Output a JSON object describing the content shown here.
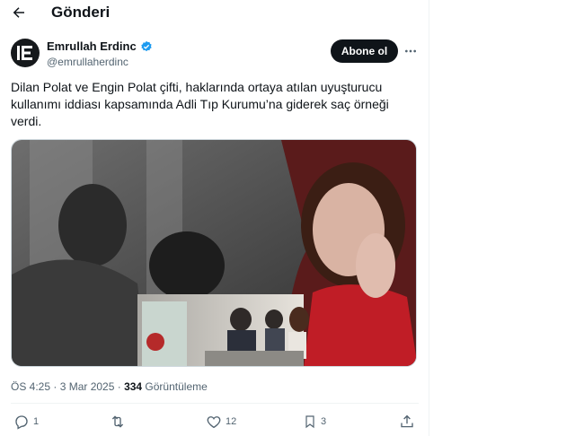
{
  "header": {
    "title": "Gönderi"
  },
  "author": {
    "name": "Emrullah Erdinc",
    "handle": "@emrullaherdinc",
    "verified": true,
    "avatar_text": "E"
  },
  "subscribe_label": "Abone ol",
  "tweet": {
    "lines": [
      "Dilan Polat ve Engin Polat çifti, haklarında ortaya atılan uyuşturucu",
      "kullanımı iddiası kapsamında Adli Tıp Kurumu’na giderek saç örneği",
      "verdi."
    ]
  },
  "meta": {
    "time_date": "ÖS 4:25 · 3 Mar 2025 · ",
    "views_count": "334",
    "views_label": " Görüntüleme"
  },
  "actions": {
    "replies": "1",
    "reposts": "",
    "likes": "12",
    "bookmarks": "3"
  },
  "colors": {
    "accent": "#1d9bf0",
    "button": "#0f1419",
    "muted": "#536471",
    "media_red": "#b31b23"
  }
}
